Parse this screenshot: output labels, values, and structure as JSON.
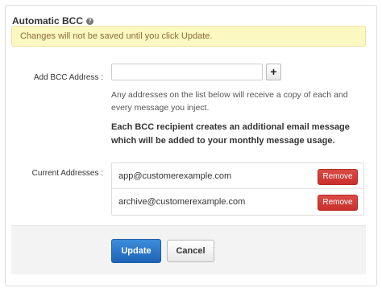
{
  "panel": {
    "title": "Automatic BCC",
    "help_icon": "question-circle-icon"
  },
  "alert": {
    "text": "Changes will not be saved until you click Update."
  },
  "add_bcc": {
    "label": "Add BCC Address :",
    "input_value": "",
    "add_button_label": "+",
    "help_text": "Any addresses on the list below will receive a copy of each and every message you inject.",
    "warning_text": "Each BCC recipient creates an additional email message which will be added to your monthly message usage."
  },
  "current": {
    "label": "Current Addresses :",
    "addresses": [
      {
        "email": "app@customerexample.com",
        "remove_label": "Remove"
      },
      {
        "email": "archive@customerexample.com",
        "remove_label": "Remove"
      }
    ]
  },
  "footer": {
    "update_label": "Update",
    "cancel_label": "Cancel"
  },
  "colors": {
    "alert_bg": "#fcf8c2",
    "remove_btn": "#d9534f",
    "update_btn": "#2a73c5"
  }
}
